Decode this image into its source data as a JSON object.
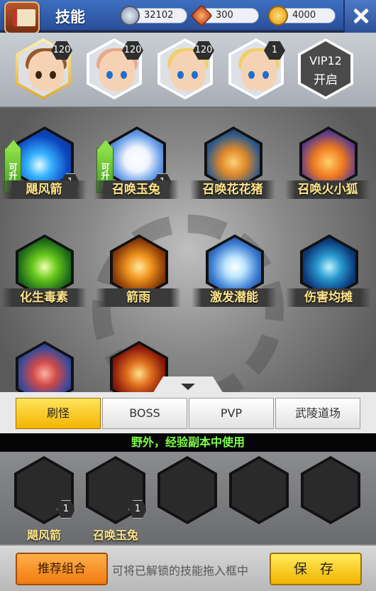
{
  "header": {
    "title": "技能"
  },
  "resources": {
    "silver": "32102",
    "gems": "300",
    "gold": "4000"
  },
  "heroes": [
    {
      "level": "120",
      "icon": "hero-brown-hair-icon"
    },
    {
      "level": "120",
      "icon": "hero-pink-hair-icon"
    },
    {
      "level": "120",
      "icon": "hero-blonde-hair-icon"
    },
    {
      "level": "1",
      "icon": "hero-blonde-hair-icon"
    }
  ],
  "vip": {
    "line1": "VIP12",
    "line2": "开启"
  },
  "skills": [
    {
      "name": "飓风箭",
      "level": "1",
      "upgrade": "可升级",
      "icon": "wind-arrow-icon"
    },
    {
      "name": "召唤玉兔",
      "level": "1",
      "upgrade": "可升级",
      "icon": "jade-rabbit-icon"
    },
    {
      "name": "召唤花花猪",
      "icon": "flower-pig-icon"
    },
    {
      "name": "召唤火小狐",
      "icon": "fire-fox-icon"
    },
    {
      "name": "化生毒素",
      "icon": "poison-icon"
    },
    {
      "name": "箭雨",
      "icon": "arrow-rain-icon"
    },
    {
      "name": "激发潜能",
      "icon": "burst-potential-icon"
    },
    {
      "name": "伤害均摊",
      "icon": "damage-share-icon"
    },
    {
      "name": "",
      "icon": "sorceress-icon"
    },
    {
      "name": "",
      "icon": "golden-dragon-icon"
    }
  ],
  "tabs": [
    "刷怪",
    "BOSS",
    "PVP",
    "武陵道场"
  ],
  "hint": "野外，经验副本中使用",
  "slots": [
    {
      "name": "飓风箭",
      "level": "1"
    },
    {
      "name": "召唤玉兔",
      "level": "1"
    }
  ],
  "bottom": {
    "recommend": "推荐组合",
    "drag_hint": "可将已解锁的技能拖入框中",
    "save": "保 存"
  }
}
